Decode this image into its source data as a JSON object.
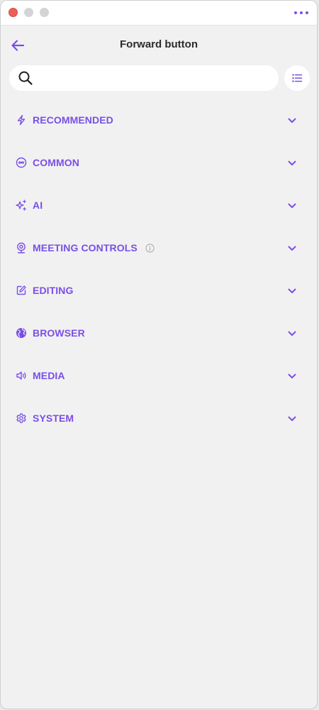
{
  "colors": {
    "accent": "#7a4fe6",
    "title": "#2b2b2e",
    "info": "#a9a9ae",
    "search_icon": "#1f1f22"
  },
  "window": {
    "traffic_lights": [
      "close",
      "minimize",
      "maximize"
    ],
    "more_icon": "ellipsis-icon"
  },
  "header": {
    "back_icon": "arrow-left-icon",
    "title": "Forward button"
  },
  "search": {
    "icon": "search-icon",
    "value": "",
    "placeholder": ""
  },
  "list_toggle": {
    "icon": "list-icon"
  },
  "categories": [
    {
      "label": "RECOMMENDED",
      "icon": "bolt-icon"
    },
    {
      "label": "COMMON",
      "icon": "infinity-circle-icon"
    },
    {
      "label": "AI",
      "icon": "sparkles-icon"
    },
    {
      "label": "MEETING CONTROLS",
      "icon": "webcam-icon",
      "info_icon": "info-icon"
    },
    {
      "label": "EDITING",
      "icon": "edit-icon"
    },
    {
      "label": "BROWSER",
      "icon": "globe-icon"
    },
    {
      "label": "MEDIA",
      "icon": "speaker-icon"
    },
    {
      "label": "SYSTEM",
      "icon": "gear-icon"
    }
  ]
}
